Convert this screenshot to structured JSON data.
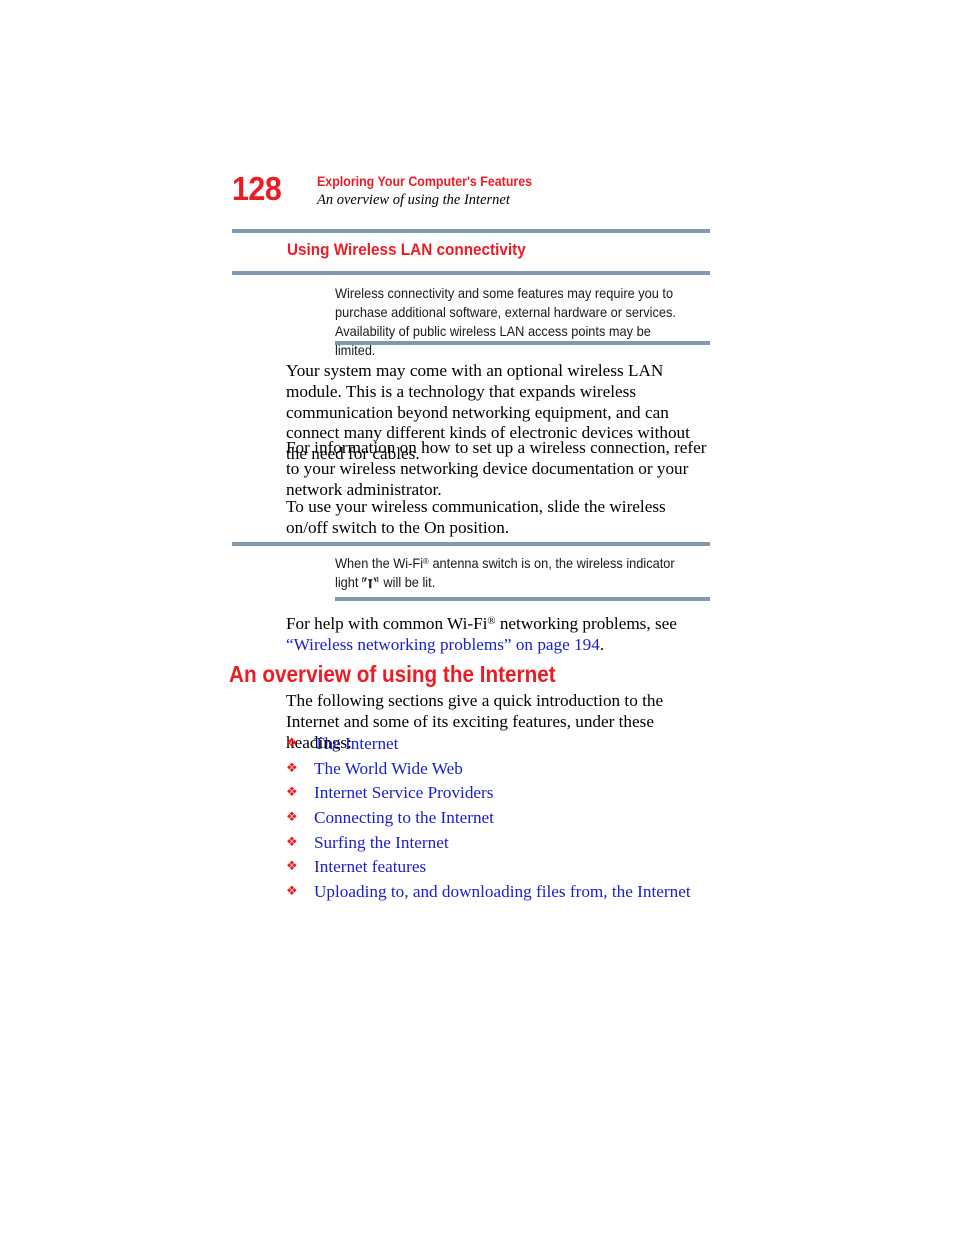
{
  "page": {
    "number": "128",
    "header_title": "Exploring Your Computer's Features",
    "header_subtitle": "An overview of using the Internet",
    "colors": {
      "accent_red": "#ec1c24",
      "rule_blue": "#8099b0",
      "link_blue": "#1a20cc",
      "body_black": "#000000"
    }
  },
  "section_wireless": {
    "heading": "Using Wireless LAN connectivity",
    "note_1": "Wireless connectivity and some features may require you to purchase additional software, external hardware or services. Availability of public wireless LAN access points may be limited.",
    "paragraphs": [
      "Your system may come with an optional wireless LAN module. This is a technology that expands wireless communication beyond networking equipment, and can connect many different kinds of electronic devices without the need for cables.",
      "For information on how to set up a wireless connection, refer to your wireless networking device documentation or your network administrator.",
      "To use your wireless communication, slide the wireless on/off switch to the On position."
    ],
    "note_2": {
      "before_icon": "When the Wi-Fi® antenna switch is on, the wireless indicator light",
      "after_icon": "will be lit.",
      "icon_name": "wireless-indicator-icon"
    },
    "help_paragraph": {
      "lead": "For help with common Wi-Fi",
      "registered": "®",
      "middle": " networking problems, see ",
      "link_text": "“Wireless networking problems” on page 194",
      "trailing": "."
    }
  },
  "section_internet": {
    "heading": "An overview of using the Internet",
    "intro": "The following sections give a quick introduction to the Internet and some of its exciting features, under these headings:",
    "bullet_glyph": "❖",
    "links": [
      "The Internet",
      "The World Wide Web",
      "Internet Service Providers",
      "Connecting to the Internet",
      "Surfing the Internet",
      "Internet features",
      "Uploading to, and downloading files from, the Internet"
    ]
  }
}
